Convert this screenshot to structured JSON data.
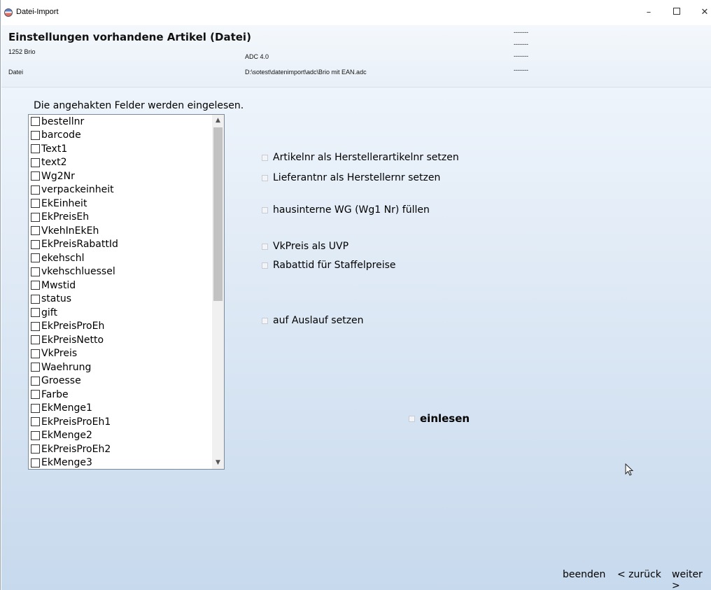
{
  "window": {
    "title": "Datei-Import",
    "min_label": "–",
    "close_label": "✕"
  },
  "header": {
    "title": "Einstellungen vorhandene Artikel (Datei)",
    "subtitle": "1252 Brio",
    "format": "ADC 4.0",
    "file_label": "Datei",
    "file_path": "D:\\sotest\\datenimport\\adc\\Brio mit EAN.adc",
    "status_lines": [
      "-------",
      "-------",
      "-------",
      "-------"
    ]
  },
  "fields": {
    "intro": "Die angehakten Felder werden eingelesen.",
    "items": [
      "bestellnr",
      "barcode",
      "Text1",
      "text2",
      "Wg2Nr",
      "verpackeinheit",
      "EkEinheit",
      "EkPreisEh",
      "VkehInEkEh",
      "EkPreisRabattId",
      "ekehschl",
      "vkehschluessel",
      "Mwstid",
      "status",
      "gift",
      "EkPreisProEh",
      "EkPreisNetto",
      "VkPreis",
      "Waehrung",
      "Groesse",
      "Farbe",
      "EkMenge1",
      "EkPreisProEh1",
      "EkMenge2",
      "EkPreisProEh2",
      "EkMenge3"
    ]
  },
  "options": {
    "artikelnr": "Artikelnr als Herstellerartikelnr setzen",
    "lieferantnr": "Lieferantnr als Herstellernr setzen",
    "hausinterne": "hausinterne WG (Wg1 Nr) füllen",
    "vkpreis": "VkPreis als UVP",
    "rabattid": "Rabattid für Staffelpreise",
    "auslauf": "auf Auslauf setzen",
    "einlesen": "einlesen"
  },
  "footer": {
    "beenden": "beenden",
    "zurueck": "< zurück",
    "weiter": "weiter >"
  }
}
